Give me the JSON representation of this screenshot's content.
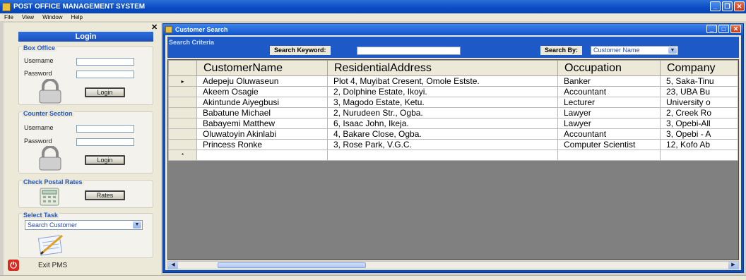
{
  "app": {
    "title": "POST OFFICE MANAGEMENT SYSTEM"
  },
  "menu": [
    "File",
    "View",
    "Window",
    "Help"
  ],
  "login": {
    "header": "Login",
    "box_office": {
      "title": "Box Office",
      "username_label": "Username",
      "password_label": "Password",
      "login_button": "Login"
    },
    "counter_section": {
      "title": "Counter Section",
      "username_label": "Username",
      "password_label": "Password",
      "login_button": "Login"
    }
  },
  "postal_rates": {
    "title": "Check Postal Rates",
    "button": "Rates"
  },
  "select_task": {
    "title": "Select Task",
    "selected": "Search Customer"
  },
  "exit": {
    "label": "Exit PMS"
  },
  "child_window": {
    "title": "Customer Search",
    "criteria_title": "Search Criteria",
    "keyword_label": "Search Keyword:",
    "keyword_value": "",
    "search_by_label": "Search By:",
    "search_by_value": "Customer Name"
  },
  "grid": {
    "columns": [
      "CustomerName",
      "ResidentialAddress",
      "Occupation",
      "Company"
    ],
    "rows": [
      [
        "Adepeju Oluwaseun",
        "Plot 4, Muyibat Cresent, Omole Estste.",
        "Banker",
        "5, Saka-Tinu"
      ],
      [
        "Akeem Osagie",
        "2, Dolphine Estate, Ikoyi.",
        "Accountant",
        "23, UBA Bu"
      ],
      [
        "Akintunde Aiyegbusi",
        "3, Magodo Estate, Ketu.",
        "Lecturer",
        "University o"
      ],
      [
        "Babatune Michael",
        "2, Nurudeen Str., Ogba.",
        "Lawyer",
        "2, Creek Ro"
      ],
      [
        "Babayemi Matthew",
        "6, Isaac John, Ikeja.",
        "Lawyer",
        "3, Opebi-All"
      ],
      [
        "Oluwatoyin Akinlabi",
        "4, Bakare Close, Ogba.",
        "Accountant",
        "3, Opebi - A"
      ],
      [
        "Princess Ronke",
        "3, Rose Park, V.G.C.",
        "Computer Scientist",
        "12, Kofo Ab"
      ]
    ],
    "current_row_marker": "▸",
    "new_row_marker": "*"
  },
  "colors": {
    "titlebar": "#0a4ac4",
    "child_bg": "#0b4ec0",
    "accent_text": "#2457c5"
  }
}
